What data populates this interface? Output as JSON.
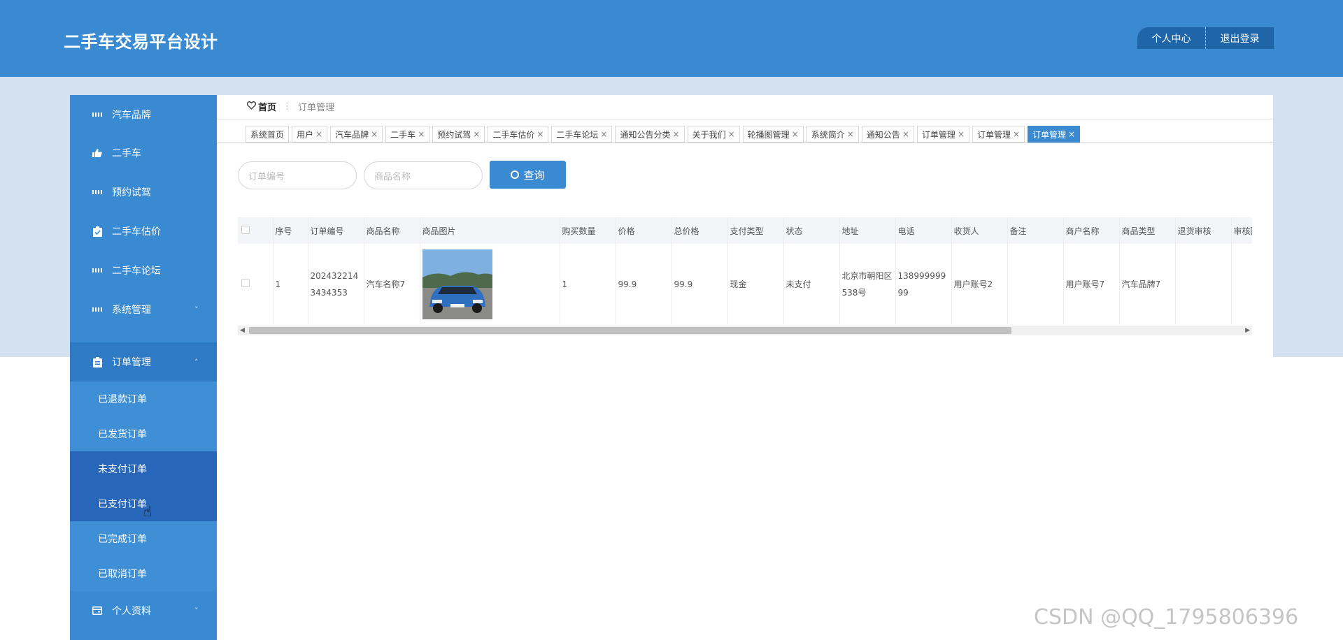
{
  "header": {
    "title": "二手车交易平台设计",
    "profile_label": "个人中心",
    "logout_label": "退出登录"
  },
  "sidebar": {
    "items": [
      {
        "label": "汽车品牌",
        "icon": "grid-icon"
      },
      {
        "label": "二手车",
        "icon": "thumbs-up-icon"
      },
      {
        "label": "预约试驾",
        "icon": "grid-icon"
      },
      {
        "label": "二手车估价",
        "icon": "clipboard-check-icon"
      },
      {
        "label": "二手车论坛",
        "icon": "grid-icon"
      },
      {
        "label": "系统管理",
        "icon": "grid-icon",
        "chevron": "˅"
      },
      {
        "label": "订单管理",
        "icon": "clipboard-icon",
        "chevron": "˄"
      }
    ],
    "submenu": [
      "已退款订单",
      "已发货订单",
      "未支付订单",
      "已支付订单",
      "已完成订单",
      "已取消订单"
    ],
    "profile_item": {
      "label": "个人资料",
      "icon": "wallet-icon",
      "chevron": "˅"
    }
  },
  "breadcrumb": {
    "home": "首页",
    "current": "订单管理"
  },
  "tabs": [
    {
      "label": "系统首页",
      "closable": false
    },
    {
      "label": "用户",
      "closable": true
    },
    {
      "label": "汽车品牌",
      "closable": true
    },
    {
      "label": "二手车",
      "closable": true
    },
    {
      "label": "预约试驾",
      "closable": true
    },
    {
      "label": "二手车估价",
      "closable": true
    },
    {
      "label": "二手车论坛",
      "closable": true
    },
    {
      "label": "通知公告分类",
      "closable": true
    },
    {
      "label": "关于我们",
      "closable": true
    },
    {
      "label": "轮播图管理",
      "closable": true
    },
    {
      "label": "系统简介",
      "closable": true
    },
    {
      "label": "通知公告",
      "closable": true
    },
    {
      "label": "订单管理",
      "closable": true
    },
    {
      "label": "订单管理",
      "closable": true
    },
    {
      "label": "订单管理",
      "closable": true,
      "active": true
    }
  ],
  "search": {
    "order_no_placeholder": "订单编号",
    "goods_name_placeholder": "商品名称",
    "button_label": "查询"
  },
  "table": {
    "columns": [
      "序号",
      "订单编号",
      "商品名称",
      "商品图片",
      "购买数量",
      "价格",
      "总价格",
      "支付类型",
      "状态",
      "地址",
      "电话",
      "收货人",
      "备注",
      "商户名称",
      "商品类型",
      "退货审核",
      "审核回复"
    ],
    "rows": [
      {
        "index": "1",
        "order_no": "2024322143434353",
        "goods_name": "汽车名称7",
        "quantity": "1",
        "price": "99.9",
        "total": "99.9",
        "pay_type": "现金",
        "status": "未支付",
        "address": "北京市朝阳区538号",
        "phone": "13899999999",
        "receiver": "用户账号2",
        "remark": "",
        "merchant": "用户账号7",
        "goods_type": "汽车品牌7",
        "return_audit": "",
        "audit_reply": ""
      }
    ]
  },
  "watermark": "CSDN @QQ_1795806396",
  "colors": {
    "primary": "#3a8ad2",
    "header_button": "#1f65a8",
    "band": "#d3e1f0",
    "submenu_highlight": "#2766b9"
  }
}
